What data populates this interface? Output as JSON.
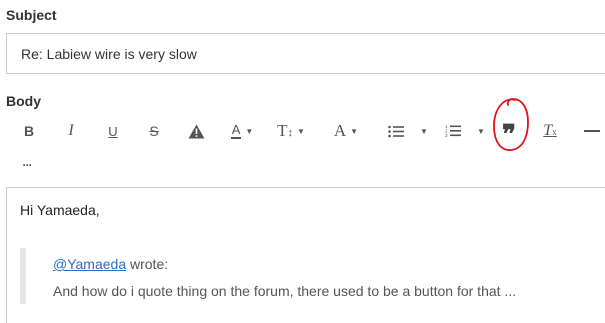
{
  "subject": {
    "label": "Subject",
    "value": "Re: Labiew wire is very slow"
  },
  "body": {
    "label": "Body",
    "toolbar": {
      "bold": "B",
      "italic": "I",
      "underline": "U",
      "strikethrough": "S",
      "font_color": "A",
      "font_size": "T",
      "font_size_arrows": "↕",
      "font_family": "A",
      "clear_format": "T",
      "clear_format_sub": "x",
      "more": "···",
      "quote": "❞",
      "icons": {
        "warning": "warning-icon",
        "bullet_list": "bullet-list-icon",
        "numbered_list": "numbered-list-icon",
        "quote": "quote-icon",
        "horizontal_rule": "horizontal-rule-icon",
        "more": "more-icon"
      }
    },
    "content": {
      "greeting": "Hi Yamaeda,",
      "quote_author": "@Yamaeda",
      "quote_wrote": " wrote:",
      "quote_text": "And how do i quote thing on the forum, there used to be a button for that ..."
    }
  },
  "colors": {
    "annotation": "#e0141e",
    "link": "#2a6ebb",
    "border": "#cccccc"
  }
}
